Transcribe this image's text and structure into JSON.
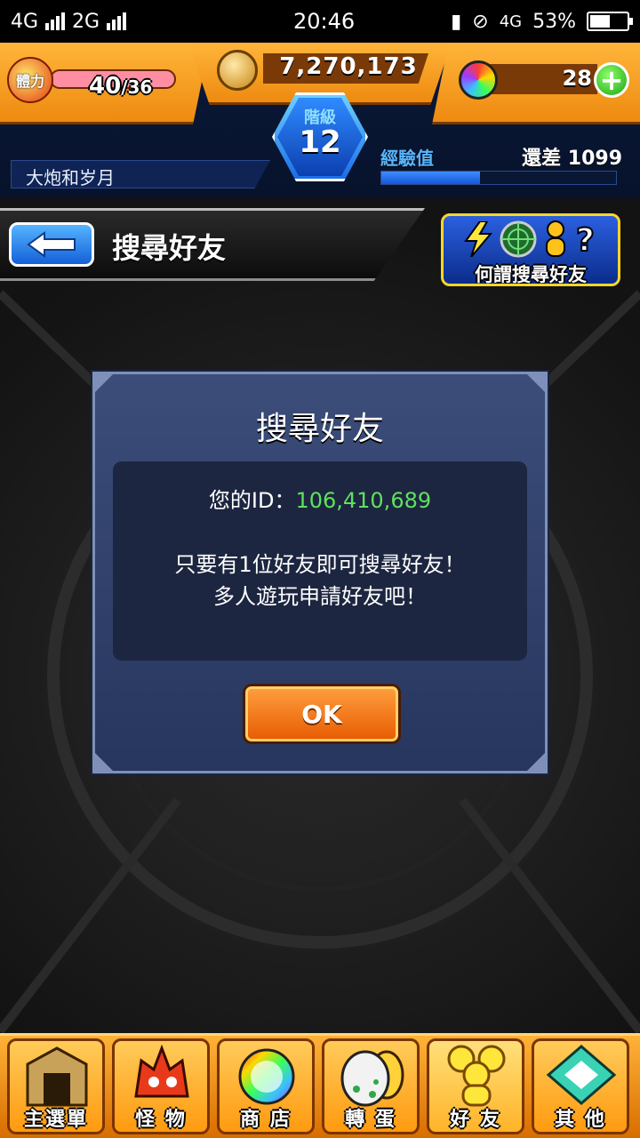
{
  "status_bar": {
    "network1": "4G",
    "network2": "2G",
    "time": "20:46",
    "network3": "4G",
    "battery": "53%"
  },
  "hud": {
    "stamina_label": "體力",
    "stamina_current": "40",
    "stamina_max": "/36",
    "money": "7,270,173",
    "orbs": "28",
    "plus": "+",
    "player_name": "大炮和岁月",
    "rank_label": "階級",
    "rank_value": "12",
    "exp_label": "經驗值",
    "exp_remaining": "還差 1099",
    "exp_progress": 0.42
  },
  "titlebar": {
    "title": "搜尋好友",
    "help_label": "何謂搜尋好友"
  },
  "dialog": {
    "title": "搜尋好友",
    "id_label": "您的ID：",
    "id_value": "106,410,689",
    "message_line1": "只要有1位好友即可搜尋好友！",
    "message_line2": "多人遊玩申請好友吧！",
    "ok_label": "OK"
  },
  "bottom_nav": [
    {
      "label": "主選單",
      "icon": "gate-icon"
    },
    {
      "label": "怪 物",
      "icon": "monster-icon"
    },
    {
      "label": "商 店",
      "icon": "orb-icon"
    },
    {
      "label": "轉 蛋",
      "icon": "egg-icon"
    },
    {
      "label": "好 友",
      "icon": "friends-icon"
    },
    {
      "label": "其 他",
      "icon": "other-icon"
    }
  ],
  "colors": {
    "accent_orange": "#ff9a10",
    "dialog_blue": "#3c4d7a",
    "id_green": "#5fe05f"
  }
}
